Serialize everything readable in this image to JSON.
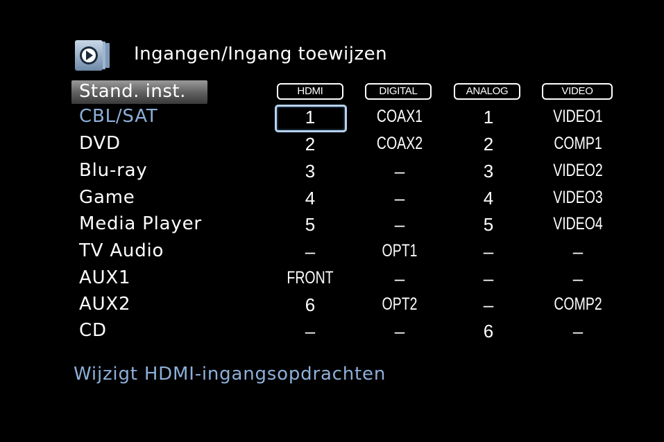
{
  "header": {
    "icon": "menu-arrow-icon",
    "title": "Ingangen/Ingang toewijzen"
  },
  "default_button": "Stand. inst.",
  "columns": [
    "HDMI",
    "DIGITAL",
    "ANALOG",
    "VIDEO"
  ],
  "rows": [
    {
      "label": "CBL/SAT",
      "hdmi": "1",
      "digital": "COAX1",
      "analog": "1",
      "video": "VIDEO1"
    },
    {
      "label": "DVD",
      "hdmi": "2",
      "digital": "COAX2",
      "analog": "2",
      "video": "COMP1"
    },
    {
      "label": "Blu-ray",
      "hdmi": "3",
      "digital": "–",
      "analog": "3",
      "video": "VIDEO2"
    },
    {
      "label": "Game",
      "hdmi": "4",
      "digital": "–",
      "analog": "4",
      "video": "VIDEO3"
    },
    {
      "label": "Media Player",
      "hdmi": "5",
      "digital": "–",
      "analog": "5",
      "video": "VIDEO4"
    },
    {
      "label": "TV Audio",
      "hdmi": "–",
      "digital": "OPT1",
      "analog": "–",
      "video": "–"
    },
    {
      "label": "AUX1",
      "hdmi": "FRONT",
      "digital": "–",
      "analog": "–",
      "video": "–"
    },
    {
      "label": "AUX2",
      "hdmi": "6",
      "digital": "OPT2",
      "analog": "–",
      "video": "COMP2"
    },
    {
      "label": "CD",
      "hdmi": "–",
      "digital": "–",
      "analog": "6",
      "video": "–"
    }
  ],
  "selected": {
    "row": "CBL/SAT",
    "column": "HDMI"
  },
  "hint": "Wijzigt HDMI-ingangsopdrachten",
  "colors": {
    "background": "#000000",
    "text": "#ffffff",
    "accent": "#8db0da",
    "selection": "#b7d2ee"
  }
}
